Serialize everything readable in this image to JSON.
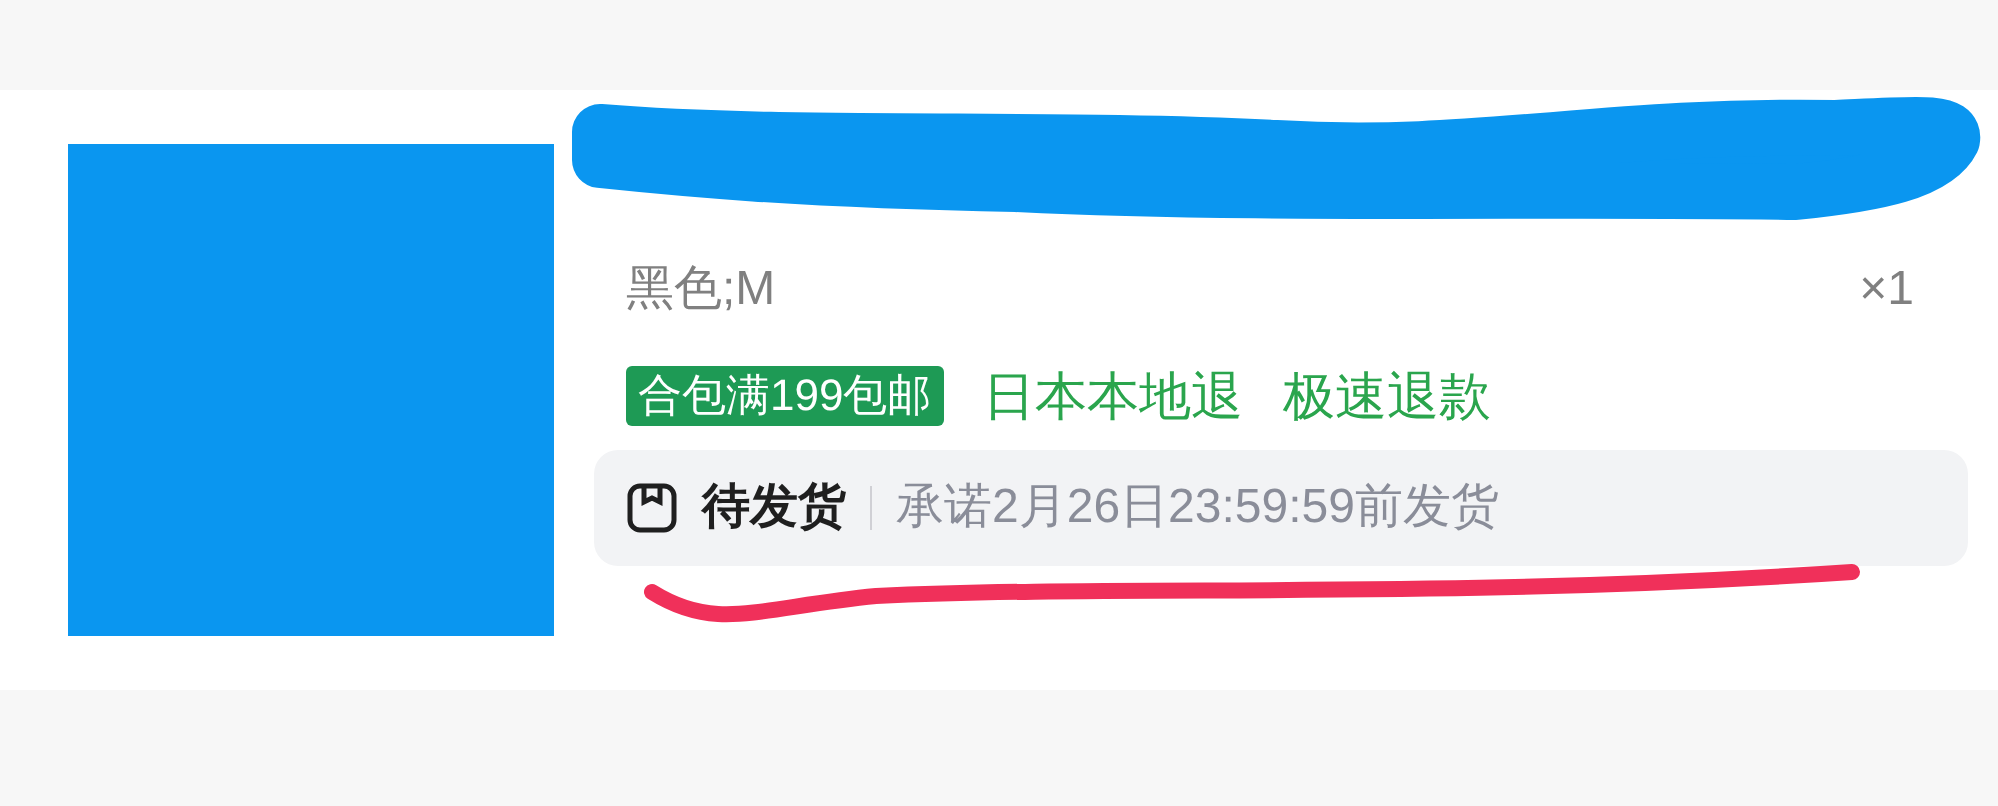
{
  "product": {
    "variant": "黑色;M",
    "quantity": "×1",
    "tags": [
      {
        "kind": "filled",
        "label": "合包满199包邮"
      },
      {
        "kind": "plain",
        "label": "日本本地退"
      },
      {
        "kind": "plain",
        "label": "极速退款"
      }
    ],
    "status": {
      "label": "待发货",
      "note": "承诺2月26日23:59:59前发货"
    }
  }
}
